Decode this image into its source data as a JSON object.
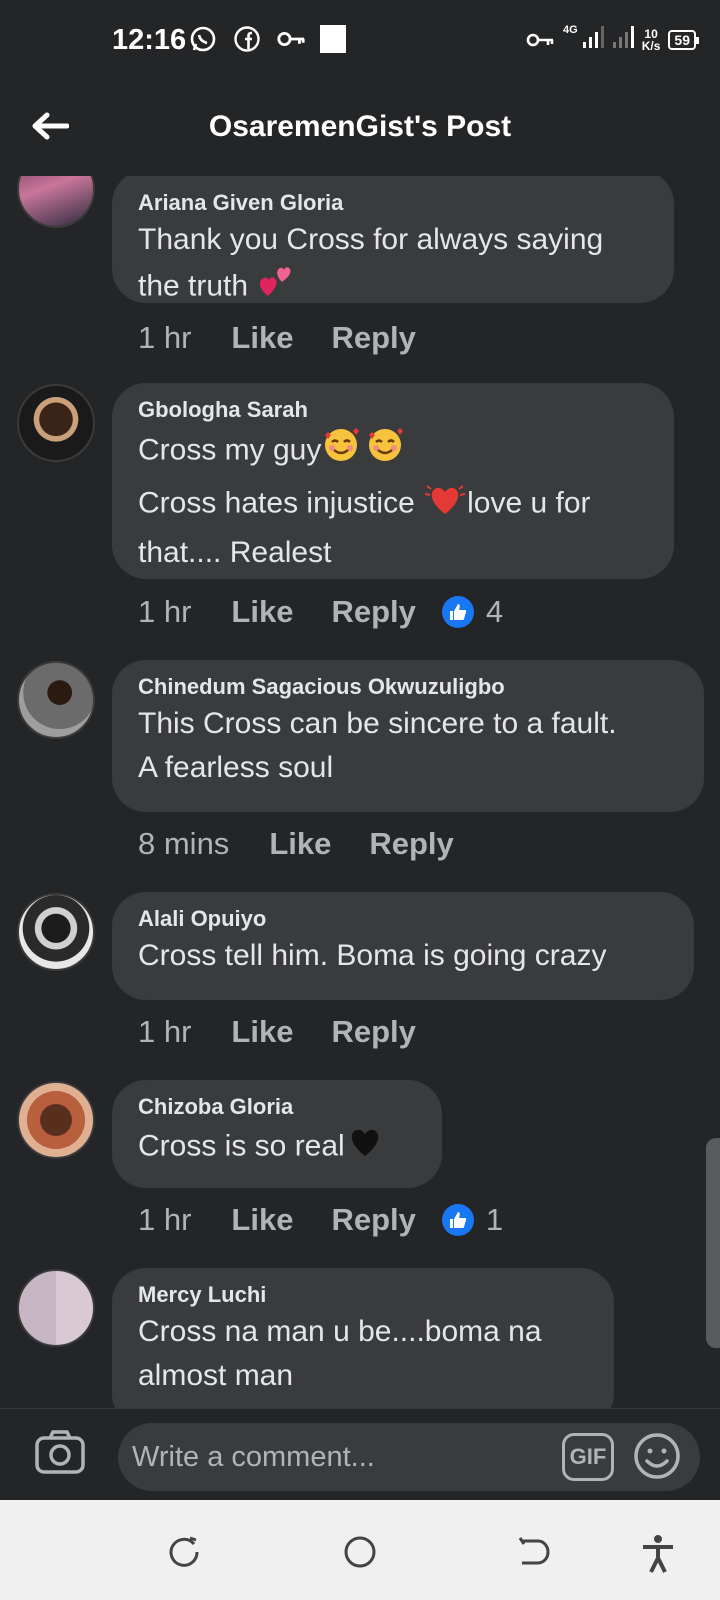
{
  "status_bar": {
    "time": "12:16",
    "network": "4G",
    "speed_value": "10",
    "speed_unit": "K/s",
    "battery": "59"
  },
  "header": {
    "title": "OsaremenGist's Post"
  },
  "comments": [
    {
      "name": "Ariana Given Gloria",
      "lines": [
        "Thank you Cross for always saying",
        "the truth"
      ],
      "time": "1 hr",
      "like_label": "Like",
      "reply_label": "Reply",
      "emojis": [
        "two-hearts"
      ]
    },
    {
      "name": "Gbologha Sarah",
      "lines": [
        "Cross my guy",
        "Cross hates injustice",
        "love u for",
        "that.... Realest"
      ],
      "time": "1 hr",
      "like_label": "Like",
      "reply_label": "Reply",
      "reaction_count": "4"
    },
    {
      "name": "Chinedum Sagacious Okwuzuligbo",
      "lines": [
        "This Cross can be sincere to a fault.",
        "A fearless soul"
      ],
      "time": "8 mins",
      "like_label": "Like",
      "reply_label": "Reply"
    },
    {
      "name": "Alali Opuiyo",
      "lines": [
        "Cross tell him. Boma is going crazy"
      ],
      "time": "1 hr",
      "like_label": "Like",
      "reply_label": "Reply"
    },
    {
      "name": "Chizoba Gloria",
      "lines": [
        "Cross is so real"
      ],
      "time": "1 hr",
      "like_label": "Like",
      "reply_label": "Reply",
      "reaction_count": "1"
    },
    {
      "name": "Mercy Luchi",
      "lines": [
        "Cross na man u be....boma na",
        "almost man"
      ]
    }
  ],
  "composer": {
    "placeholder": "Write a comment...",
    "gif_label": "GIF"
  },
  "colors": {
    "background": "#242527",
    "bubble": "#3a3b3c",
    "text_primary": "#e4e6eb",
    "text_secondary": "#b0b3b8",
    "like_blue": "#1877f2",
    "nav_bar": "#f0f0f0"
  }
}
